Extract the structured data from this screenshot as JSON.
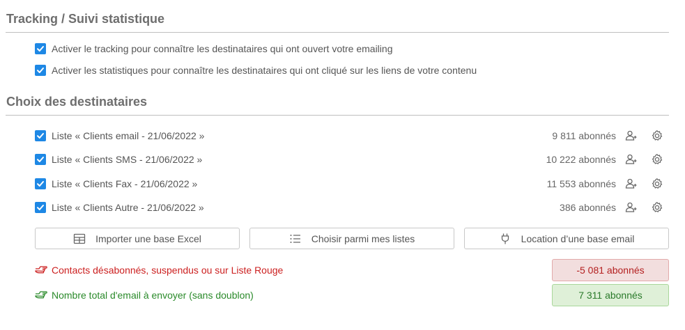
{
  "tracking": {
    "title": "Tracking / Suivi statistique",
    "options": [
      {
        "label": "Activer le tracking pour connaître les destinataires qui ont ouvert votre emailing",
        "checked": true
      },
      {
        "label": "Activer les statistiques pour connaître les destinataires qui ont cliqué sur les liens de votre contenu",
        "checked": true
      }
    ]
  },
  "recipients": {
    "title": "Choix des destinataires",
    "lists": [
      {
        "label": "Liste « Clients email - 21/06/2022 »",
        "count": "9 811 abonnés",
        "checked": true
      },
      {
        "label": "Liste « Clients SMS - 21/06/2022 »",
        "count": "10 222 abonnés",
        "checked": true
      },
      {
        "label": "Liste « Clients Fax - 21/06/2022 »",
        "count": "11 553 abonnés",
        "checked": true
      },
      {
        "label": "Liste « Clients Autre - 21/06/2022 »",
        "count": "386 abonnés",
        "checked": true
      }
    ],
    "buttons": {
      "import_excel": "Importer une base Excel",
      "choose_lists": "Choisir parmi mes listes",
      "rent_base": "Location d’une base email"
    }
  },
  "summary": {
    "unsubscribed_label": "Contacts désabonnés, suspendus ou sur Liste Rouge",
    "unsubscribed_value": "-5 081 abonnés",
    "total_label": "Nombre total d'email à envoyer (sans doublon)",
    "total_value": "7 311 abonnés"
  },
  "colors": {
    "accent": "#1e88e5",
    "danger": "#cc2020",
    "success": "#2a8a2a"
  },
  "icons": [
    "check-icon",
    "add-user-icon",
    "gear-icon",
    "table-icon",
    "list-icon",
    "plug-icon",
    "pointing-hand-icon"
  ]
}
